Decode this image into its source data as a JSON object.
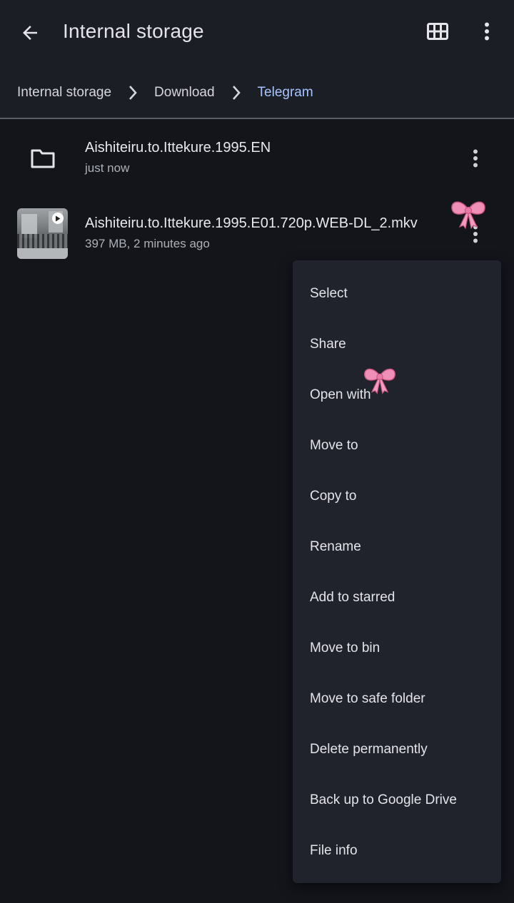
{
  "header": {
    "title": "Internal storage",
    "back_icon": "arrow-left-icon",
    "grid_icon": "grid-view-icon",
    "more_icon": "more-vert-icon"
  },
  "breadcrumb": {
    "items": [
      "Internal storage",
      "Download",
      "Telegram"
    ],
    "active_color": "#a8c4ff"
  },
  "files": [
    {
      "name": "Aishiteiru.to.Ittekure.1995.EN",
      "meta": "just now",
      "icon": "folder-icon"
    },
    {
      "name": "Aishiteiru.to.Ittekure.1995.E01.720p.WEB-DL_2.mkv",
      "meta": "397 MB, 2 minutes ago",
      "icon": "video-thumbnail"
    }
  ],
  "context_menu": {
    "items": [
      "Select",
      "Share",
      "Open with",
      "Move to",
      "Copy to",
      "Rename",
      "Add to starred",
      "Move to bin",
      "Move to safe folder",
      "Delete permanently",
      "Back up to Google Drive",
      "File info"
    ]
  },
  "colors": {
    "background": "#13151b",
    "header": "#1c1e26",
    "menu": "#20232c",
    "sticker": "#f08fb8"
  }
}
